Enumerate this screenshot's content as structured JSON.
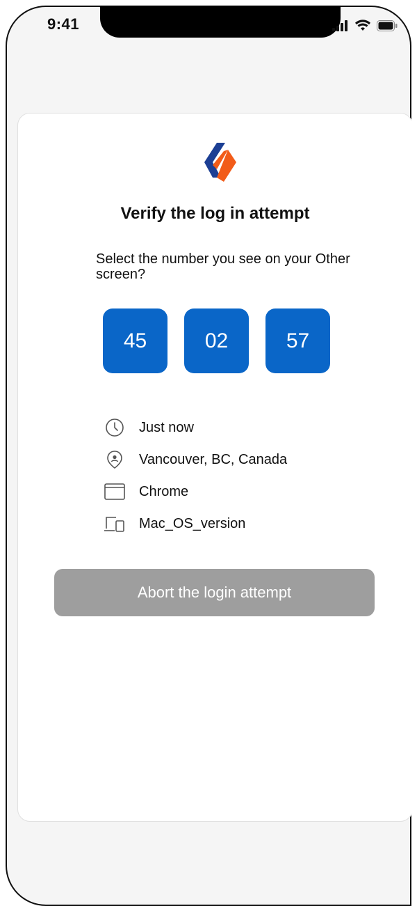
{
  "status_bar": {
    "time": "9:41",
    "icons": [
      "signal-icon",
      "wifi-icon",
      "battery-icon"
    ]
  },
  "card": {
    "logo": "brand-logo",
    "title": "Verify the log in attempt",
    "instruction": "Select the number you see on your Other screen?",
    "numbers": [
      "45",
      "02",
      "57"
    ],
    "details": [
      {
        "icon": "clock-icon",
        "text": "Just now"
      },
      {
        "icon": "location-pin-icon",
        "text": "Vancouver, BC, Canada"
      },
      {
        "icon": "browser-window-icon",
        "text": "Chrome"
      },
      {
        "icon": "devices-icon",
        "text": "Mac_OS_version"
      }
    ],
    "abort_label": "Abort the login attempt"
  },
  "colors": {
    "accent": "#0a66c8",
    "logo_orange": "#f25c19",
    "logo_navy": "#1c3f94",
    "button_disabled": "#9e9e9e",
    "background": "#f5f5f5"
  }
}
